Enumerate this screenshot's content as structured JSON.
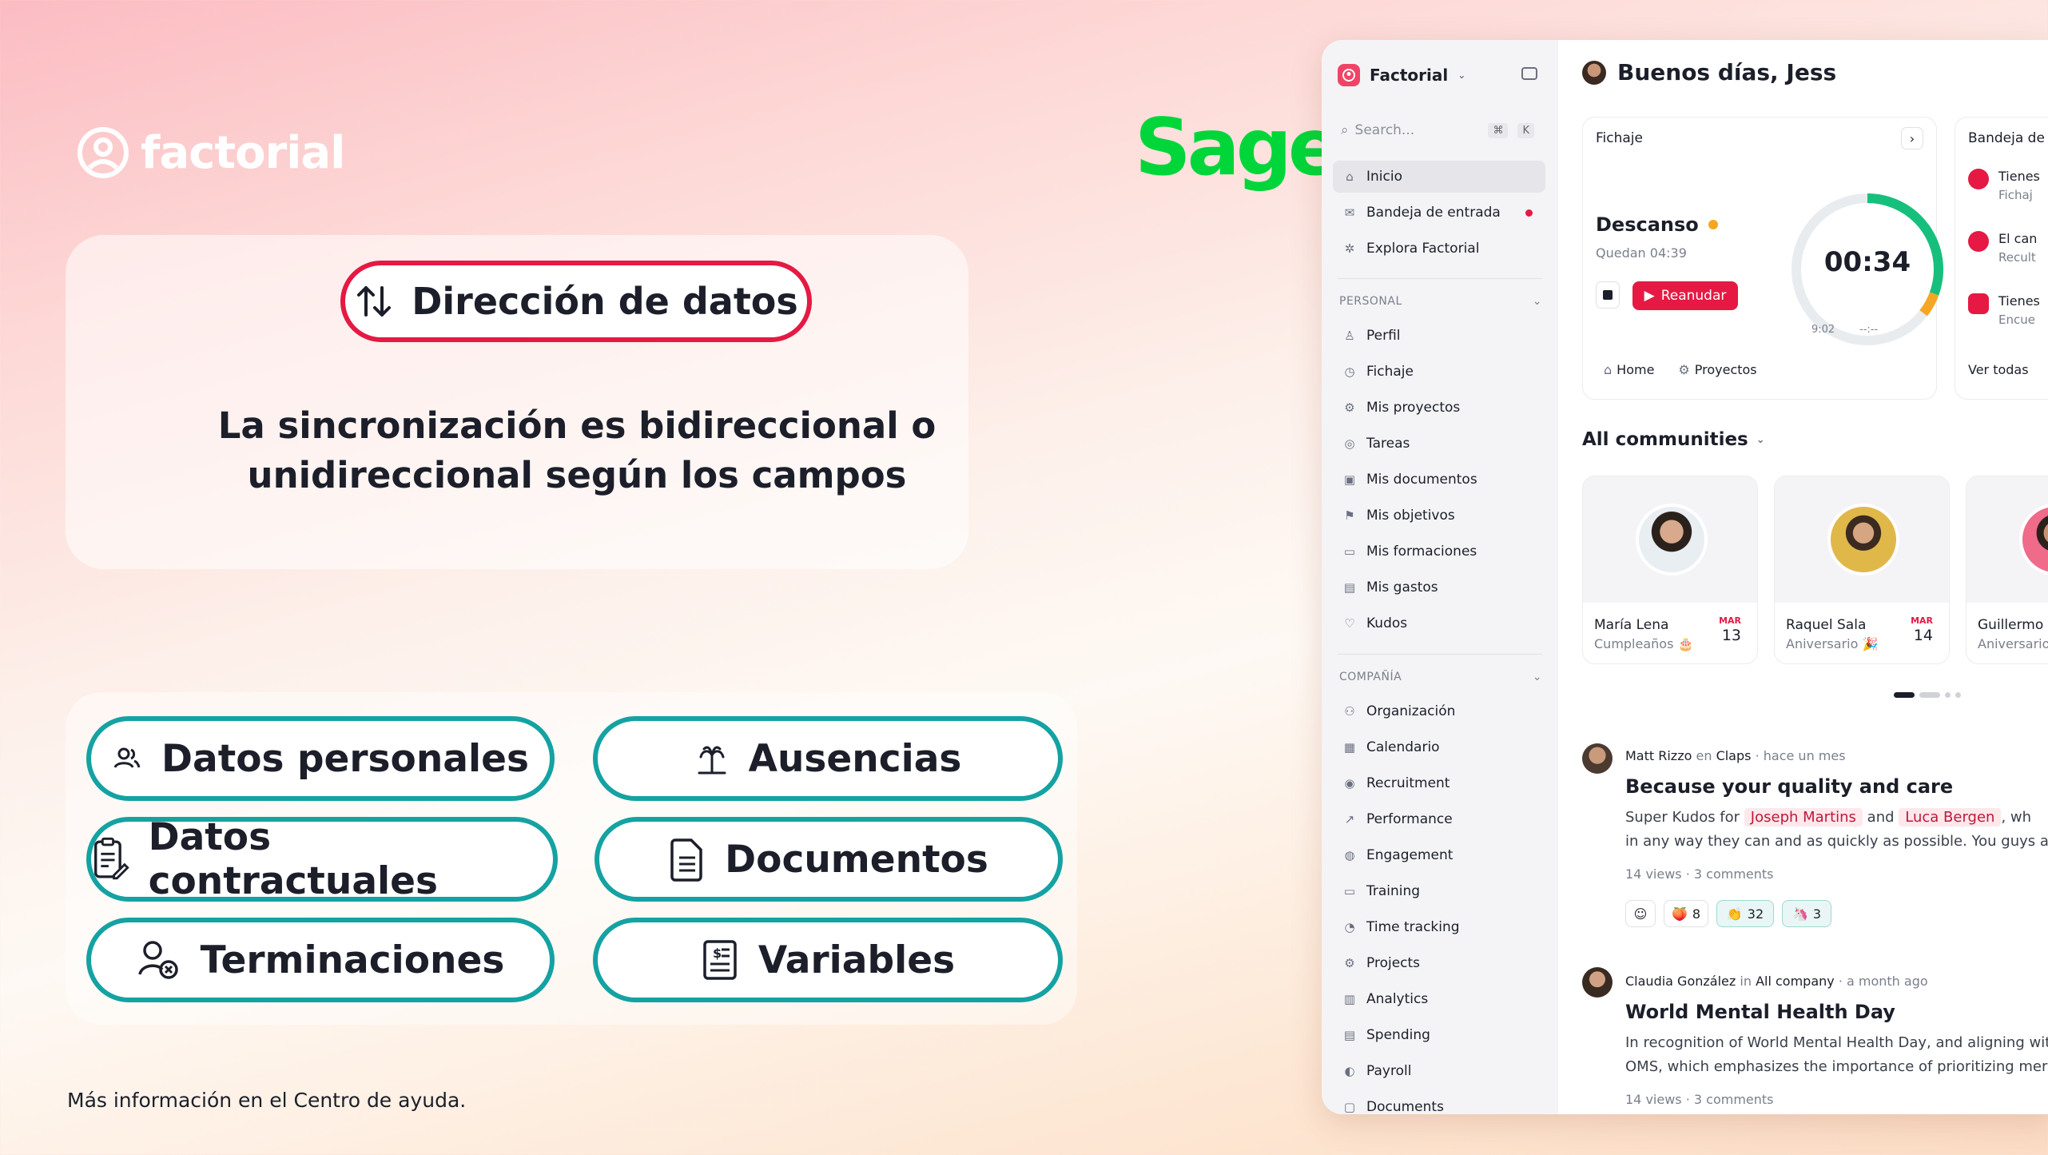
{
  "promo": {
    "logo_text": "factorial",
    "partner_logo": "Sage",
    "title": "Dirección de datos",
    "subtitle_line1": "La sincronización es bidireccional o",
    "subtitle_line2": "unidireccional según los campos",
    "pills": [
      {
        "label": "Datos personales",
        "icon": "users-icon"
      },
      {
        "label": "Ausencias",
        "icon": "palm-tree-icon"
      },
      {
        "label": "Datos contractuales",
        "icon": "contract-icon"
      },
      {
        "label": "Documentos",
        "icon": "document-icon"
      },
      {
        "label": "Terminaciones",
        "icon": "user-remove-icon"
      },
      {
        "label": "Variables",
        "icon": "payslip-icon"
      }
    ],
    "footer": "Más información en el Centro de ayuda."
  },
  "colors": {
    "accent_red": "#e51943",
    "teal": "#14a2a2",
    "sage_green": "#00d639"
  },
  "app": {
    "brand": "Factorial",
    "search_placeholder": "Search...",
    "search_shortcut": [
      "⌘",
      "K"
    ],
    "nav_top": [
      "Inicio",
      "Bandeja de entrada",
      "Explora Factorial"
    ],
    "section_personal": "PERSONAL",
    "nav_personal": [
      "Perfil",
      "Fichaje",
      "Mis proyectos",
      "Tareas",
      "Mis documentos",
      "Mis objetivos",
      "Mis formaciones",
      "Mis gastos",
      "Kudos"
    ],
    "section_company": "COMPAÑÍA",
    "nav_company": [
      "Organización",
      "Calendario",
      "Recruitment",
      "Performance",
      "Engagement",
      "Training",
      "Time tracking",
      "Projects",
      "Analytics",
      "Spending",
      "Payroll",
      "Documents"
    ],
    "greeting": "Buenos días, Jess",
    "fichaje": {
      "title": "Fichaje",
      "status": "Descanso",
      "remaining": "Quedan 04:39",
      "resume_button": "Reanudar",
      "timer": "00:34",
      "start_time": "9:02",
      "end_time": "--:--",
      "chips": [
        "Home",
        "Proyectos"
      ]
    },
    "inbox": {
      "title": "Bandeja de",
      "items": [
        {
          "title": "Tienes",
          "sub": "Fichaj"
        },
        {
          "title": "El can",
          "sub": "Recult"
        },
        {
          "title": "Tienes",
          "sub": "Encue"
        }
      ],
      "link": "Ver todas"
    },
    "communities_title": "All communities",
    "community_cards": [
      {
        "name": "María Lena",
        "event": "Cumpleaños 🎂",
        "month": "MAR",
        "day": "13"
      },
      {
        "name": "Raquel Sala",
        "event": "Aniversario 🎉",
        "month": "MAR",
        "day": "14"
      },
      {
        "name": "Guillermo S",
        "event": "Aniversario",
        "month": "",
        "day": ""
      }
    ],
    "posts": [
      {
        "author": "Matt Rizzo",
        "in_word": "en",
        "group": "Claps",
        "time": "· hace un mes",
        "title": "Because your quality and care",
        "body_prefix": "Super Kudos for",
        "mention1": "Joseph Martins",
        "and_word": "and",
        "mention2": "Luca Bergen",
        "body_suffix": ", wh",
        "body_line2": "in any way they can and as quickly as possible. You guys a",
        "stats": "14 views · 3 comments",
        "reactions": [
          {
            "emoji": "🍑",
            "count": "8"
          },
          {
            "emoji": "👏",
            "count": "32"
          },
          {
            "emoji": "🦄",
            "count": "3"
          }
        ]
      },
      {
        "author": "Claudia González",
        "in_word": "in",
        "group": "All company",
        "time": "· a month ago",
        "title": "World Mental Health Day",
        "body_line1": "In recognition of World Mental Health Day, and aligning wit",
        "body_line2": "OMS, which emphasizes the importance of prioritizing mer",
        "stats": "14 views · 3 comments"
      }
    ]
  }
}
